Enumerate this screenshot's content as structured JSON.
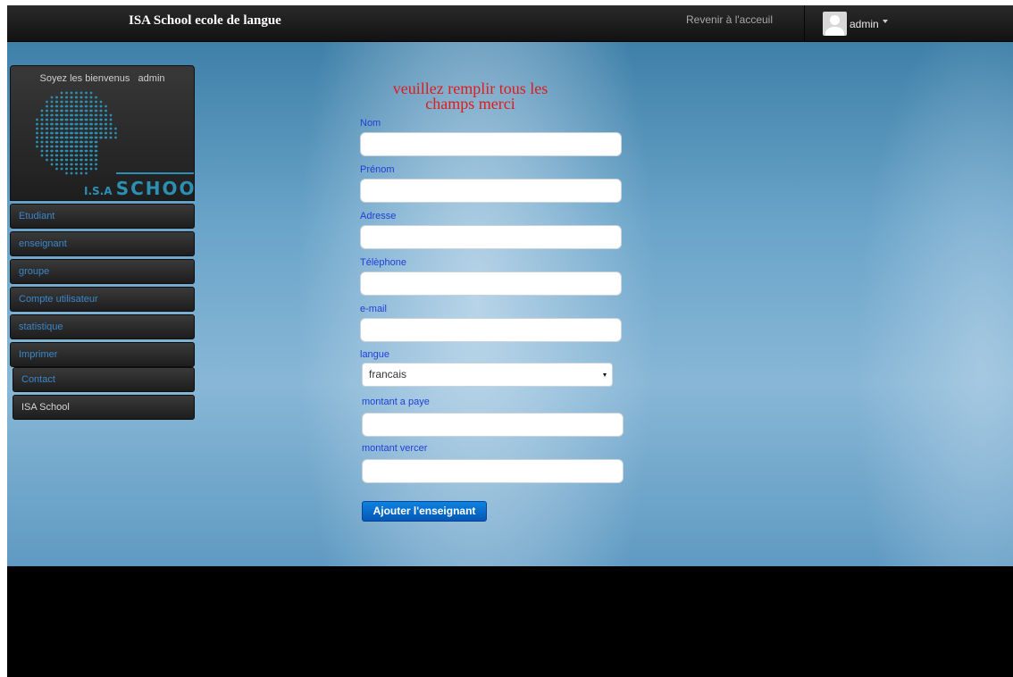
{
  "navbar": {
    "brand": "ISA School ecole de langue",
    "home_link": "Revenir à l'acceuil",
    "user_name": "admin",
    "user_icon": "user-avatar-icon",
    "dropdown_icon": "caret-down-icon"
  },
  "sidebar": {
    "welcome": "Soyez les bienvenus   admin",
    "logo_text": "I.S.A SCHOOL",
    "items": [
      {
        "label": "Etudiant"
      },
      {
        "label": "enseignant"
      },
      {
        "label": "groupe"
      },
      {
        "label": "Compte utilisateur"
      },
      {
        "label": "statistique"
      },
      {
        "label": "Imprimer"
      },
      {
        "label": "Contact"
      },
      {
        "label": "ISA School"
      }
    ]
  },
  "form": {
    "heading_line1": "veuillez remplir tous les",
    "heading_line2": "champs merci",
    "fields": {
      "nom": {
        "label": "Nom",
        "value": ""
      },
      "prenom": {
        "label": "Prénom",
        "value": ""
      },
      "adresse": {
        "label": "Adresse",
        "value": ""
      },
      "telephone": {
        "label": "Télèphone",
        "value": ""
      },
      "email": {
        "label": "e-mail",
        "value": ""
      },
      "langue": {
        "label": "langue",
        "selected": "francais"
      },
      "montant_paye": {
        "label": "montant a paye",
        "value": ""
      },
      "montant_vercer": {
        "label": "montant vercer",
        "value": ""
      }
    },
    "submit_label": "Ajouter l'enseignant"
  },
  "colors": {
    "accent_link": "#3c86c9",
    "label_blue": "#1f3fd8",
    "heading_red": "#e01b1b",
    "button_blue": "#0a6fd0",
    "logo_teal": "#2c8fb4"
  }
}
